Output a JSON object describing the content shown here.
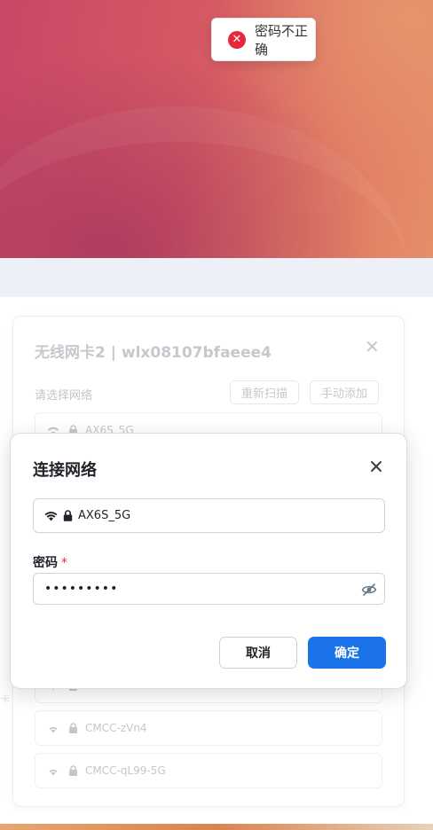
{
  "toast": {
    "icon": "error-circle-icon",
    "message": "密码不正确"
  },
  "panel": {
    "title": "无线网卡2 | wlx08107bfaeee4",
    "subtitle": "请选择网络",
    "rescan_label": "重新扫描",
    "manual_add_label": "手动添加",
    "networks": [
      {
        "ssid": "AX6S_5G"
      },
      {
        "ssid": ""
      },
      {
        "ssid": "CMCC-zVn4"
      },
      {
        "ssid": "CMCC-qL99-5G"
      }
    ],
    "side_hint_left": "卡"
  },
  "dialog": {
    "title": "连接网络",
    "ssid_value": "AX6S_5G",
    "password_label": "密码",
    "required_mark": "*",
    "password_value": "•••••••••",
    "cancel_label": "取消",
    "confirm_label": "确定"
  },
  "colors": {
    "primary": "#1a73e8",
    "error": "#e8283a",
    "hero_start": "#c84866",
    "hero_end": "#e58e69"
  }
}
